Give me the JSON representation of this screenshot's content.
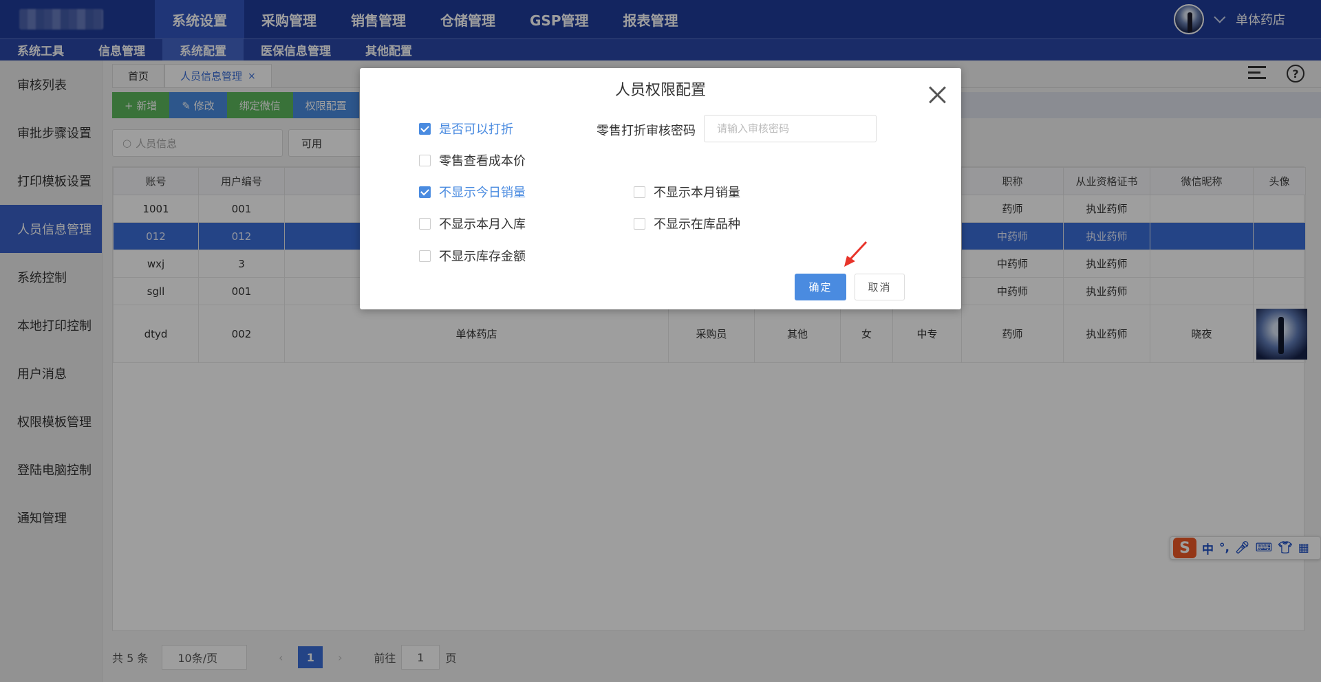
{
  "top_menu": [
    "系统设置",
    "采购管理",
    "销售管理",
    "仓储管理",
    "GSP管理",
    "报表管理"
  ],
  "user": {
    "name": "单体药店"
  },
  "sub_menu": [
    "系统工具",
    "信息管理",
    "系统配置",
    "医保信息管理",
    "其他配置"
  ],
  "sidebar": [
    "审核列表",
    "审批步骤设置",
    "打印模板设置",
    "人员信息管理",
    "系统控制",
    "本地打印控制",
    "用户消息",
    "权限模板管理",
    "登陆电脑控制",
    "通知管理"
  ],
  "tabs": {
    "home": "首页",
    "current": "人员信息管理",
    "close": "×"
  },
  "toolbar": {
    "add": "+ 新增",
    "edit": "✎ 修改",
    "bind": "绑定微信",
    "perm": "权限配置"
  },
  "filters": {
    "search_placeholder": "人员信息",
    "status": "可用"
  },
  "table": {
    "headers": [
      "账号",
      "用户编号",
      "",
      "",
      "",
      "",
      "",
      "职称",
      "从业资格证书",
      "微信昵称",
      "头像"
    ],
    "rows": [
      [
        "1001",
        "001",
        "",
        "",
        "",
        "",
        "",
        "药师",
        "执业药师",
        "",
        ""
      ],
      [
        "012",
        "012",
        "",
        "",
        "",
        "",
        "",
        "中药师",
        "执业药师",
        "",
        ""
      ],
      [
        "wxj",
        "3",
        "",
        "",
        "",
        "",
        "",
        "中药师",
        "执业药师",
        "",
        ""
      ],
      [
        "sgll",
        "001",
        "",
        "",
        "",
        "",
        "",
        "中药师",
        "执业药师",
        "",
        ""
      ],
      [
        "dtyd",
        "002",
        "单体药店",
        "采购员",
        "其他",
        "女",
        "中专",
        "药师",
        "执业药师",
        "晓夜",
        ""
      ]
    ]
  },
  "pager": {
    "total": "共 5 条",
    "size": "10条/页",
    "page": "1",
    "goto_label": "前往",
    "goto_value": "1",
    "page_unit": "页",
    "prev": "‹",
    "next": "›"
  },
  "modal": {
    "title": "人员权限配置",
    "pwd_label": "零售打折审核密码",
    "pwd_placeholder": "请输入审核密码",
    "options": [
      {
        "label": "是否可以打折",
        "checked": true
      },
      {
        "label": "零售查看成本价",
        "checked": false
      },
      {
        "label": "不显示今日销量",
        "checked": true
      },
      {
        "label": "不显示本月销量",
        "checked": false
      },
      {
        "label": "不显示本月入库",
        "checked": false
      },
      {
        "label": "不显示在库品种",
        "checked": false
      },
      {
        "label": "不显示库存金额",
        "checked": false
      }
    ],
    "ok": "确定",
    "cancel": "取消"
  },
  "ime": {
    "lang": "中",
    "punct": "°,",
    "logo": "S"
  }
}
